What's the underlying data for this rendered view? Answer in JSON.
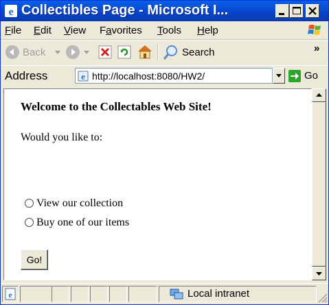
{
  "window": {
    "title": "Collectibles Page - Microsoft I..."
  },
  "menu": {
    "items": [
      {
        "pre": "",
        "key": "F",
        "post": "ile"
      },
      {
        "pre": "",
        "key": "E",
        "post": "dit"
      },
      {
        "pre": "",
        "key": "V",
        "post": "iew"
      },
      {
        "pre": "F",
        "key": "a",
        "post": "vorites"
      },
      {
        "pre": "",
        "key": "T",
        "post": "ools"
      },
      {
        "pre": "",
        "key": "H",
        "post": "elp"
      }
    ]
  },
  "toolbar": {
    "back_label": "Back",
    "search_label": "Search",
    "overflow": "»"
  },
  "address": {
    "label": "Address",
    "url": "http://localhost:8080/HW2/",
    "go_label": "Go"
  },
  "page": {
    "heading": "Welcome to the Collectables Web Site!",
    "prompt": "Would you like to:",
    "options": [
      "View our collection",
      "Buy one of our items"
    ],
    "submit_label": "Go!"
  },
  "status": {
    "zone": "Local intranet"
  }
}
